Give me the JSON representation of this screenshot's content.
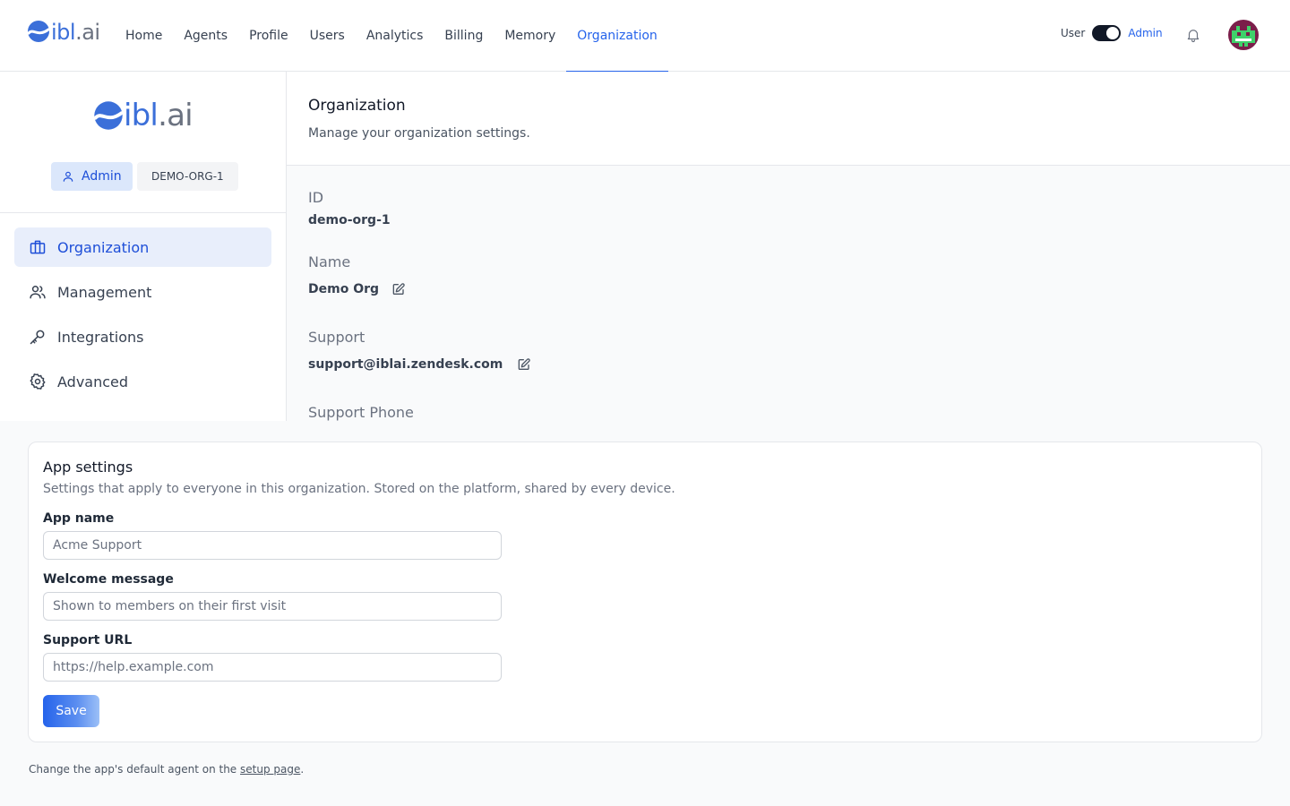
{
  "brand": {
    "name": "ibl",
    "suffix": ".ai"
  },
  "nav": {
    "items": [
      "Home",
      "Agents",
      "Profile",
      "Users",
      "Analytics",
      "Billing",
      "Memory",
      "Organization"
    ],
    "active": "Organization"
  },
  "role_switch": {
    "left_label": "User",
    "right_label": "Admin",
    "state": "Admin"
  },
  "sidebar": {
    "role_badge": "Admin",
    "org_badge": "DEMO-ORG-1",
    "items": [
      {
        "label": "Organization",
        "icon": "briefcase-icon",
        "active": true
      },
      {
        "label": "Management",
        "icon": "users-icon",
        "active": false
      },
      {
        "label": "Integrations",
        "icon": "key-icon",
        "active": false
      },
      {
        "label": "Advanced",
        "icon": "gear-icon",
        "active": false
      }
    ]
  },
  "main": {
    "title": "Organization",
    "subtitle": "Manage your organization settings.",
    "fields": {
      "id_label": "ID",
      "id_value": "demo-org-1",
      "name_label": "Name",
      "name_value": "Demo Org",
      "support_label": "Support",
      "support_value": "support@iblai.zendesk.com",
      "support_phone_label": "Support Phone"
    }
  },
  "app_settings": {
    "title": "App settings",
    "subtitle": "Settings that apply to everyone in this organization. Stored on the platform, shared by every device.",
    "app_name_label": "App name",
    "app_name_placeholder": "Acme Support",
    "welcome_label": "Welcome message",
    "welcome_placeholder": "Shown to members on their first visit",
    "support_url_label": "Support URL",
    "support_url_placeholder": "https://help.example.com",
    "save_label": "Save"
  },
  "footnote": {
    "text": "Change the app's default agent on the ",
    "link": "setup page",
    "end": "."
  },
  "colors": {
    "accent": "#2563eb",
    "active_bg": "#e8eefb",
    "brand": "#3b6fd9"
  }
}
